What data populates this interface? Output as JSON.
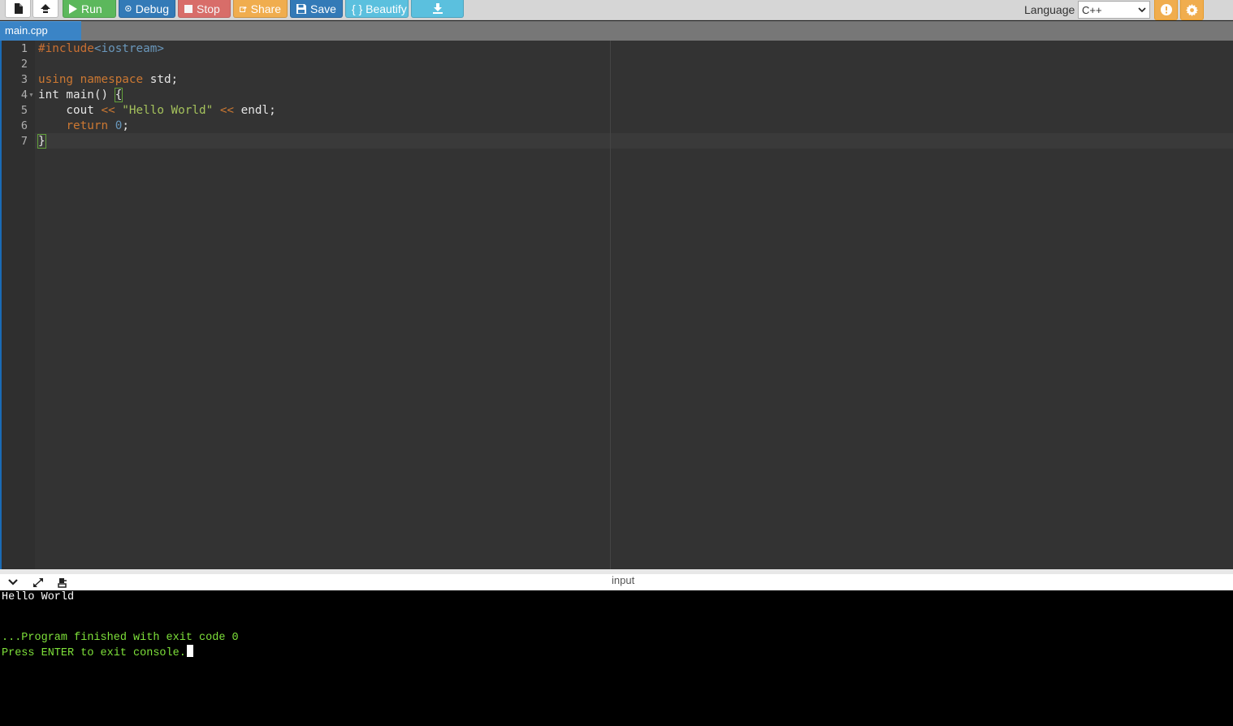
{
  "toolbar": {
    "run_label": "Run",
    "debug_label": "Debug",
    "stop_label": "Stop",
    "share_label": "Share",
    "save_label": "Save",
    "beautify_label": "{ } Beautify",
    "language_label": "Language",
    "language_selected": "C++"
  },
  "tabs": [
    {
      "label": "main.cpp",
      "active": true
    }
  ],
  "editor": {
    "line_numbers": [
      "1",
      "2",
      "3",
      "4",
      "5",
      "6",
      "7"
    ],
    "lines": {
      "l1_include": "#include",
      "l1_header": "<iostream>",
      "l3_using": "using",
      "l3_namespace": "namespace",
      "l3_rest": " std;",
      "l4_text": "int main() ",
      "l4_brace": "{",
      "l5_indent": "    cout ",
      "l5_op1": "<<",
      "l5_string": "\"Hello World\"",
      "l5_op2": "<<",
      "l5_rest": " endl;",
      "l6_return": "return",
      "l6_num": "0",
      "l6_rest": ";",
      "l7_brace": "}"
    },
    "active_line": 7
  },
  "console": {
    "input_tab_label": "input",
    "lines": [
      "Hello World",
      "",
      "",
      "...Program finished with exit code 0",
      "Press ENTER to exit console."
    ]
  },
  "colors": {
    "run": "#5cb85c",
    "debug": "#337ab7",
    "stop": "#d9534f",
    "share": "#f0ad4e",
    "save": "#337ab7",
    "beautify": "#5bc0de",
    "editor_bg": "#333333",
    "console_bg": "#000000",
    "console_green": "#7ee13a"
  }
}
